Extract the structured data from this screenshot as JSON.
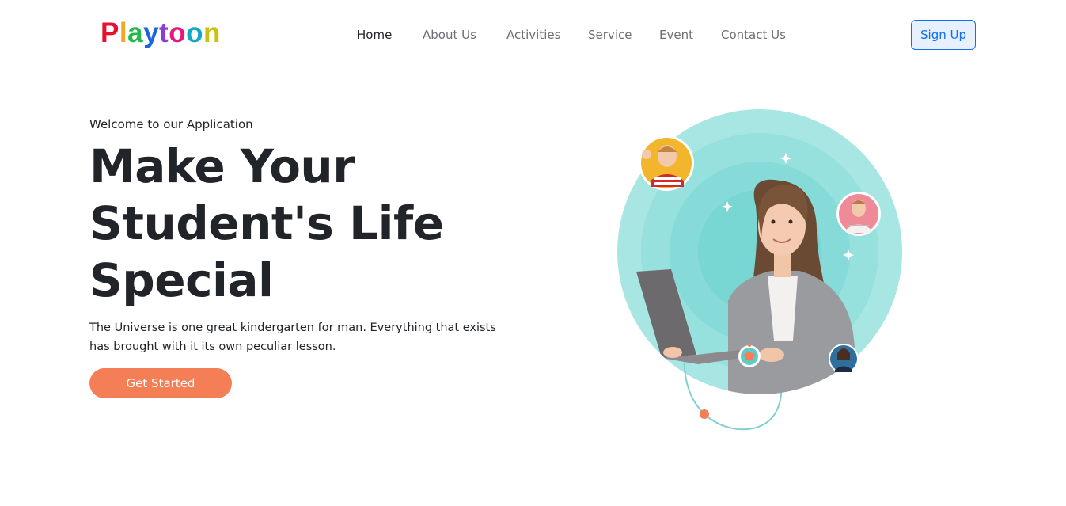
{
  "brand": {
    "letters": [
      {
        "ch": "P",
        "color": "#e8112d"
      },
      {
        "ch": "l",
        "color": "#f5a623"
      },
      {
        "ch": "a",
        "color": "#25b74a"
      },
      {
        "ch": "y",
        "color": "#1e63e0"
      },
      {
        "ch": "t",
        "color": "#8e3bd6"
      },
      {
        "ch": "o",
        "color": "#e6187e"
      },
      {
        "ch": "o",
        "color": "#11a7c9"
      },
      {
        "ch": "n",
        "color": "#c9c10e"
      }
    ]
  },
  "nav": {
    "items": [
      {
        "label": "Home",
        "active": true
      },
      {
        "label": "About Us",
        "active": false
      },
      {
        "label": "Activities",
        "active": false
      },
      {
        "label": "Service",
        "active": false
      },
      {
        "label": "Event",
        "active": false
      },
      {
        "label": "Contact Us",
        "active": false
      }
    ],
    "signup_label": "Sign Up"
  },
  "hero": {
    "welcome": "Welcome to our Application",
    "headline_lines": [
      "Make Your",
      "Student's Life",
      "Special"
    ],
    "tagline": "The Universe is one great kindergarten for man. Everything that exists has brought with it its own peculiar lesson.",
    "cta_label": "Get Started"
  },
  "colors": {
    "accent": "#f47e55",
    "primary": "#0d6efd",
    "circle_outer": "#a8e6e4",
    "circle_inner": "#7fd9d6"
  },
  "illustration": {
    "icons": [
      "teacher-with-laptop",
      "child-avatar-yellow",
      "child-avatar-pink",
      "child-avatar-blue",
      "graduation-cap-badge",
      "sparkle"
    ]
  }
}
